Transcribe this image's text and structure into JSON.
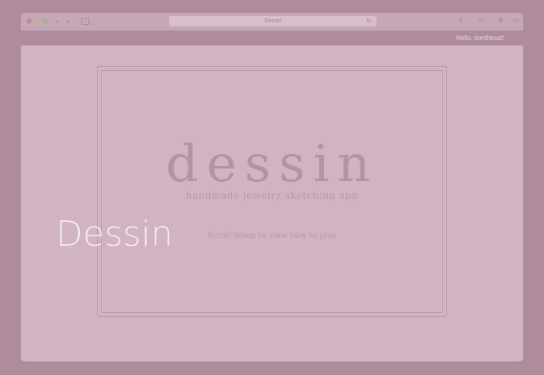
{
  "browser": {
    "page_title": "Dessin",
    "icons": {
      "back": "chevron-left-icon",
      "forward": "chevron-right-icon",
      "sidebar": "sidebar-icon",
      "reload": "reload-icon",
      "share": "share-icon",
      "tabs": "tabs-icon",
      "settings": "gear-icon",
      "more": "more-icon"
    }
  },
  "header": {
    "greeting": "Hello, tomthecat!"
  },
  "hero": {
    "logo": "dessin",
    "tagline": "handmade jewelry sketching app",
    "hint": "Scroll down to view how to play"
  },
  "overlay": {
    "title": "Dessin"
  },
  "colors": {
    "background": "#ae8c9c",
    "page": "#d2b3c3",
    "frame": "#b99aab",
    "text_muted": "#b095a2",
    "overlay_text": "#f3eaf0"
  }
}
